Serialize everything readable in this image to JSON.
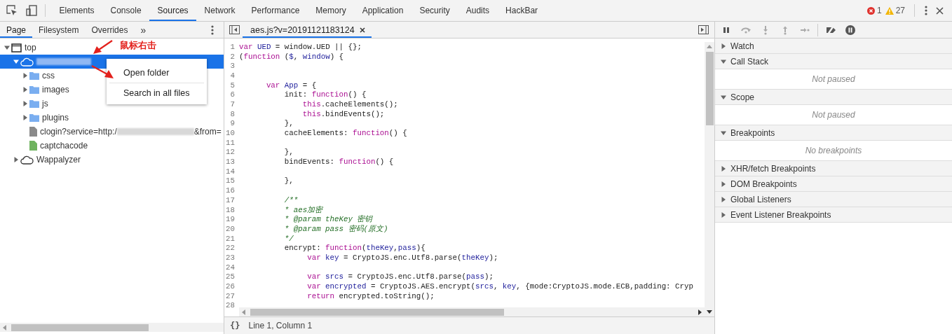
{
  "devtools_tabs": [
    {
      "label": "Elements",
      "selected": false
    },
    {
      "label": "Console",
      "selected": false
    },
    {
      "label": "Sources",
      "selected": true
    },
    {
      "label": "Network",
      "selected": false
    },
    {
      "label": "Performance",
      "selected": false
    },
    {
      "label": "Memory",
      "selected": false
    },
    {
      "label": "Application",
      "selected": false
    },
    {
      "label": "Security",
      "selected": false
    },
    {
      "label": "Audits",
      "selected": false
    },
    {
      "label": "HackBar",
      "selected": false
    }
  ],
  "status": {
    "errors": "1",
    "warnings": "27"
  },
  "navigator": {
    "tabs": [
      {
        "label": "Page",
        "selected": true
      },
      {
        "label": "Filesystem",
        "selected": false
      },
      {
        "label": "Overrides",
        "selected": false
      }
    ],
    "overflow": "»"
  },
  "tree": [
    {
      "kind": "frame",
      "segments": [
        {
          "kind": "text",
          "text": "top"
        }
      ],
      "selected": false,
      "expanded": true,
      "children": [
        {
          "kind": "domain",
          "segments": [
            {
              "kind": "redacted"
            }
          ],
          "selected": true,
          "expanded": true,
          "children": [
            {
              "kind": "folder",
              "segments": [
                {
                  "kind": "text",
                  "text": "css"
                }
              ],
              "selected": false,
              "expanded": false
            },
            {
              "kind": "folder",
              "segments": [
                {
                  "kind": "text",
                  "text": "images"
                }
              ],
              "selected": false,
              "expanded": false
            },
            {
              "kind": "folder",
              "segments": [
                {
                  "kind": "text",
                  "text": "js"
                }
              ],
              "selected": false,
              "expanded": false
            },
            {
              "kind": "folder",
              "segments": [
                {
                  "kind": "text",
                  "text": "plugins"
                }
              ],
              "selected": false,
              "expanded": false
            },
            {
              "kind": "document",
              "segments": [
                {
                  "kind": "text",
                  "text": "clogin?service=http:/"
                },
                {
                  "kind": "redacted"
                },
                {
                  "kind": "text",
                  "text": "&from="
                }
              ],
              "selected": false
            },
            {
              "kind": "image",
              "segments": [
                {
                  "kind": "text",
                  "text": "captchacode"
                }
              ],
              "selected": false
            }
          ]
        },
        {
          "kind": "domain",
          "segments": [
            {
              "kind": "text",
              "text": "Wappalyzer"
            }
          ],
          "selected": false,
          "expanded": false
        }
      ]
    }
  ],
  "context_menu": {
    "items": [
      "Open folder",
      "Search in all files"
    ]
  },
  "annotation": {
    "text": "鼠标右击"
  },
  "editor": {
    "tab": {
      "label": "aes.js?v=20191121183124"
    },
    "format_button": "{}",
    "cursor": "Line 1, Column 1",
    "lines": [
      {
        "number": "1",
        "tokens": [
          {
            "kind": "kw",
            "text": "var "
          },
          {
            "kind": "def",
            "text": "UED"
          },
          {
            "kind": "plain",
            "text": " = window.UED || {};"
          }
        ]
      },
      {
        "number": "2",
        "tokens": [
          {
            "kind": "plain",
            "text": "("
          },
          {
            "kind": "kw",
            "text": "function"
          },
          {
            "kind": "plain",
            "text": " ("
          },
          {
            "kind": "def",
            "text": "$"
          },
          {
            "kind": "plain",
            "text": ", "
          },
          {
            "kind": "def",
            "text": "window"
          },
          {
            "kind": "plain",
            "text": ") {"
          }
        ]
      },
      {
        "number": "3"
      },
      {
        "number": "4"
      },
      {
        "number": "5",
        "tokens": [
          {
            "kind": "kw",
            "text": "      var "
          },
          {
            "kind": "def",
            "text": "App"
          },
          {
            "kind": "plain",
            "text": " = {"
          }
        ]
      },
      {
        "number": "6",
        "tokens": [
          {
            "kind": "plain",
            "text": "          init: "
          },
          {
            "kind": "kw",
            "text": "function"
          },
          {
            "kind": "plain",
            "text": "() {"
          }
        ]
      },
      {
        "number": "7",
        "tokens": [
          {
            "kind": "kw",
            "text": "              this"
          },
          {
            "kind": "plain",
            "text": ".cacheElements();"
          }
        ]
      },
      {
        "number": "8",
        "tokens": [
          {
            "kind": "kw",
            "text": "              this"
          },
          {
            "kind": "plain",
            "text": ".bindEvents();"
          }
        ]
      },
      {
        "number": "9",
        "tokens": [
          {
            "kind": "plain",
            "text": "          },"
          }
        ]
      },
      {
        "number": "10",
        "tokens": [
          {
            "kind": "plain",
            "text": "          cacheElements: "
          },
          {
            "kind": "kw",
            "text": "function"
          },
          {
            "kind": "plain",
            "text": "() {"
          }
        ]
      },
      {
        "number": "11"
      },
      {
        "number": "12",
        "tokens": [
          {
            "kind": "plain",
            "text": "          },"
          }
        ]
      },
      {
        "number": "13",
        "tokens": [
          {
            "kind": "plain",
            "text": "          bindEvents: "
          },
          {
            "kind": "kw",
            "text": "function"
          },
          {
            "kind": "plain",
            "text": "() {"
          }
        ]
      },
      {
        "number": "14"
      },
      {
        "number": "15",
        "tokens": [
          {
            "kind": "plain",
            "text": "          },"
          }
        ]
      },
      {
        "number": "16"
      },
      {
        "number": "17",
        "tokens": [
          {
            "kind": "comment",
            "text": "          /**"
          }
        ]
      },
      {
        "number": "18",
        "tokens": [
          {
            "kind": "comment",
            "text": "          * aes加密"
          }
        ]
      },
      {
        "number": "19",
        "tokens": [
          {
            "kind": "comment",
            "text": "          * @param theKey 密钥"
          }
        ]
      },
      {
        "number": "20",
        "tokens": [
          {
            "kind": "comment",
            "text": "          * @param pass 密码(原文)"
          }
        ]
      },
      {
        "number": "21",
        "tokens": [
          {
            "kind": "comment",
            "text": "          */"
          }
        ]
      },
      {
        "number": "22",
        "tokens": [
          {
            "kind": "plain",
            "text": "          encrypt: "
          },
          {
            "kind": "kw",
            "text": "function"
          },
          {
            "kind": "plain",
            "text": "("
          },
          {
            "kind": "def",
            "text": "theKey"
          },
          {
            "kind": "plain",
            "text": ","
          },
          {
            "kind": "def",
            "text": "pass"
          },
          {
            "kind": "plain",
            "text": "){"
          }
        ]
      },
      {
        "number": "23",
        "tokens": [
          {
            "kind": "kw",
            "text": "               var "
          },
          {
            "kind": "def",
            "text": "key"
          },
          {
            "kind": "plain",
            "text": " = CryptoJS.enc.Utf8.parse("
          },
          {
            "kind": "def",
            "text": "theKey"
          },
          {
            "kind": "plain",
            "text": ");"
          }
        ]
      },
      {
        "number": "24"
      },
      {
        "number": "25",
        "tokens": [
          {
            "kind": "kw",
            "text": "               var "
          },
          {
            "kind": "def",
            "text": "srcs"
          },
          {
            "kind": "plain",
            "text": " = CryptoJS.enc.Utf8.parse("
          },
          {
            "kind": "def",
            "text": "pass"
          },
          {
            "kind": "plain",
            "text": ");"
          }
        ]
      },
      {
        "number": "26",
        "tokens": [
          {
            "kind": "kw",
            "text": "               var "
          },
          {
            "kind": "def",
            "text": "encrypted"
          },
          {
            "kind": "plain",
            "text": " = CryptoJS.AES.encrypt("
          },
          {
            "kind": "def",
            "text": "srcs"
          },
          {
            "kind": "plain",
            "text": ", "
          },
          {
            "kind": "def",
            "text": "key"
          },
          {
            "kind": "plain",
            "text": ", {mode:CryptoJS.mode.ECB,padding: Cryp"
          }
        ]
      },
      {
        "number": "27",
        "tokens": [
          {
            "kind": "kw",
            "text": "               return"
          },
          {
            "kind": "plain",
            "text": " encrypted.toString();"
          }
        ]
      },
      {
        "number": "28"
      }
    ]
  },
  "debugger": {
    "toolbar": [
      {
        "kind": "pause",
        "disabled": false
      },
      {
        "kind": "step-over",
        "disabled": true
      },
      {
        "kind": "step-into",
        "disabled": true
      },
      {
        "kind": "step-out",
        "disabled": true
      },
      {
        "kind": "step",
        "disabled": true
      },
      {
        "kind": "deactivate-breakpoints",
        "disabled": false
      },
      {
        "kind": "pause-on-exceptions",
        "disabled": false
      }
    ],
    "sections": [
      {
        "title": "Watch",
        "expanded": false
      },
      {
        "title": "Call Stack",
        "expanded": true,
        "message": "Not paused"
      },
      {
        "title": "Scope",
        "expanded": true,
        "message": "Not paused"
      },
      {
        "title": "Breakpoints",
        "expanded": true,
        "message": "No breakpoints"
      },
      {
        "title": "XHR/fetch Breakpoints",
        "expanded": false
      },
      {
        "title": "DOM Breakpoints",
        "expanded": false
      },
      {
        "title": "Global Listeners",
        "expanded": false
      },
      {
        "title": "Event Listener Breakpoints",
        "expanded": false
      }
    ]
  }
}
